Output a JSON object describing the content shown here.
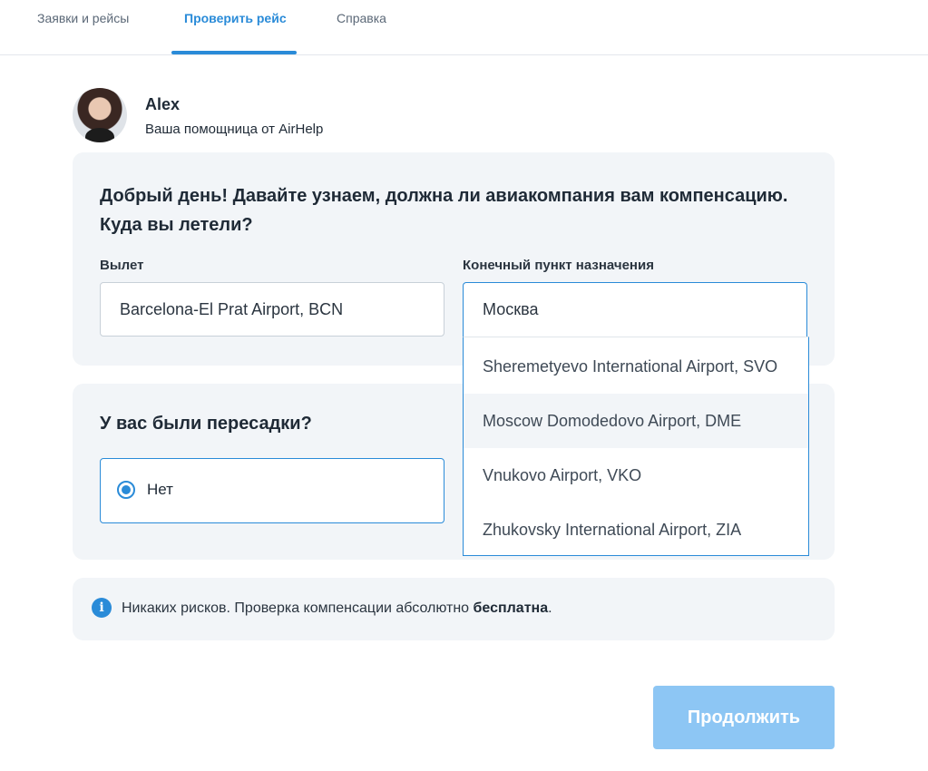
{
  "nav": {
    "tabs": [
      {
        "label": "Заявки и рейсы"
      },
      {
        "label": "Проверить рейс"
      },
      {
        "label": "Справка"
      }
    ]
  },
  "assistant": {
    "name": "Alex",
    "subtitle": "Ваша помощница от AirHelp"
  },
  "flight": {
    "question": "Добрый день! Давайте узнаем, должна ли авиакомпания вам компенсацию. Куда вы летели?",
    "departure_label": "Вылет",
    "departure_value": "Barcelona-El Prat Airport, BCN",
    "destination_label": "Конечный пункт назначения",
    "destination_value": "Москва",
    "suggestions": [
      "Sheremetyevo International Airport, SVO",
      "Moscow Domodedovo Airport, DME",
      "Vnukovo Airport, VKO",
      "Zhukovsky International Airport, ZIA"
    ]
  },
  "connections": {
    "question": "У вас были пересадки?",
    "option_no": "Нет"
  },
  "info": {
    "icon": "info-icon",
    "text": "Никаких рисков. Проверка компенсации абсолютно ",
    "bold": "бесплатна",
    "suffix": "."
  },
  "actions": {
    "continue_label": "Продолжить"
  },
  "colors": {
    "accent": "#2a8bd8",
    "card_bg": "#f2f5f8",
    "button_disabled": "#8dc6f4"
  }
}
